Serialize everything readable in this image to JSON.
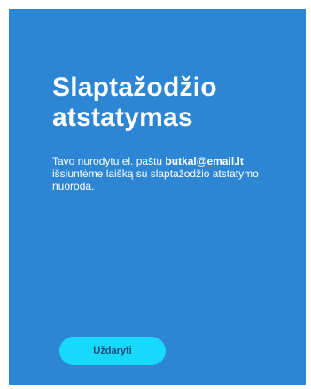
{
  "dialog": {
    "title": "Slaptažodžio atstatymas",
    "message_prefix": "Tavo nurodytu el. paštu ",
    "email": "butkal@email.lt",
    "message_suffix": " išsiuntėme laišką su slaptažodžio atstatymo nuoroda.",
    "close_label": "Uždaryti"
  },
  "colors": {
    "panel_background": "#2d86d3",
    "button_background": "#17d9fb",
    "text": "#ffffff"
  }
}
